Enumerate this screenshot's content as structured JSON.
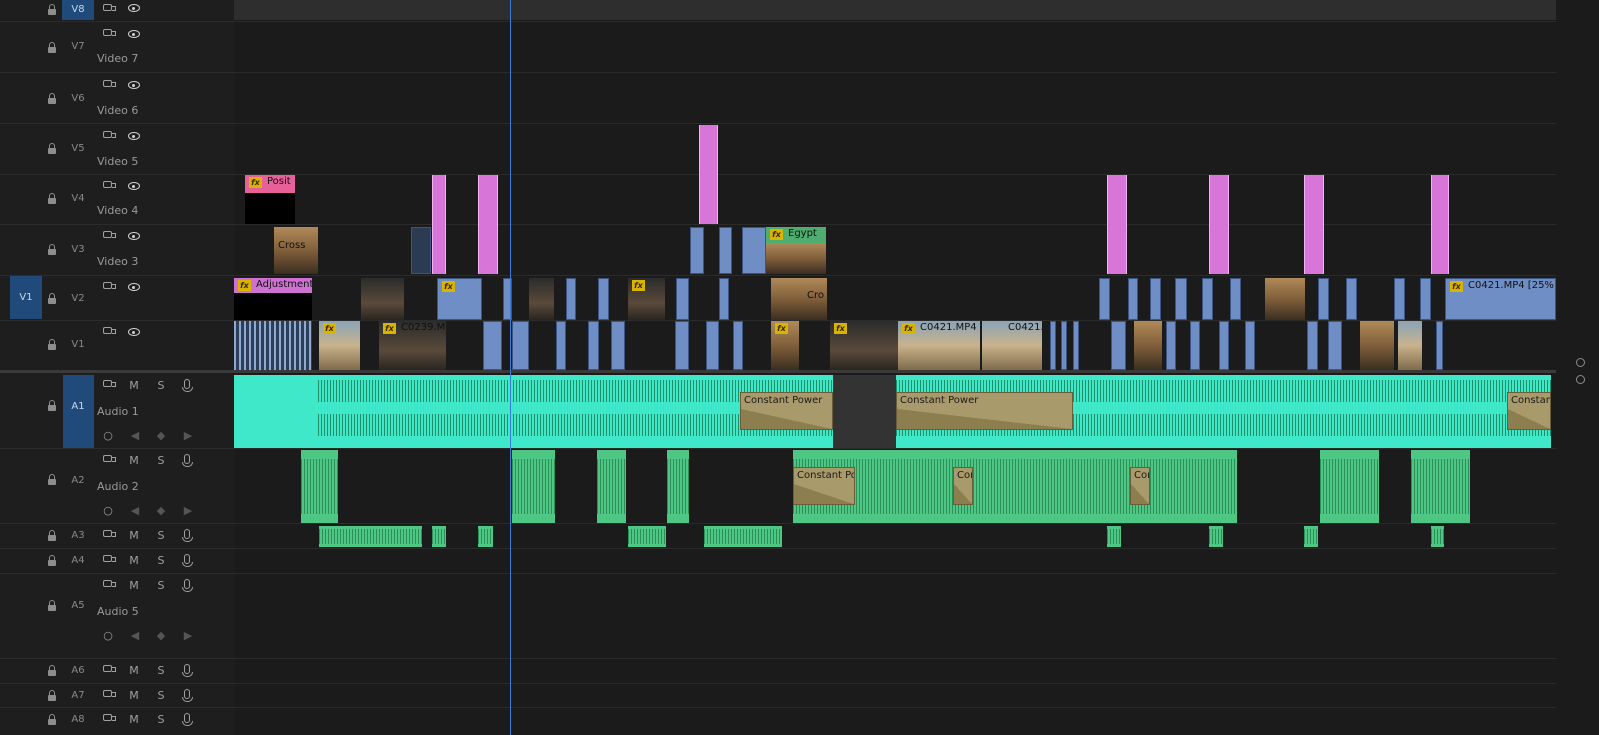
{
  "video_tracks": [
    {
      "id": "V8",
      "label": ""
    },
    {
      "id": "V7",
      "label": "Video 7"
    },
    {
      "id": "V6",
      "label": "Video 6"
    },
    {
      "id": "V5",
      "label": "Video 5"
    },
    {
      "id": "V4",
      "label": "Video 4"
    },
    {
      "id": "V3",
      "label": "Video 3"
    },
    {
      "id": "V2",
      "label": ""
    },
    {
      "id": "V1",
      "label": ""
    }
  ],
  "audio_tracks": [
    {
      "id": "A1",
      "label": "Audio 1"
    },
    {
      "id": "A2",
      "label": "Audio 2"
    },
    {
      "id": "A3",
      "label": ""
    },
    {
      "id": "A4",
      "label": ""
    },
    {
      "id": "A5",
      "label": "Audio 5"
    },
    {
      "id": "A6",
      "label": ""
    },
    {
      "id": "A7",
      "label": ""
    },
    {
      "id": "A8",
      "label": ""
    }
  ],
  "source_patch": {
    "video": "V1"
  },
  "toggles": {
    "mute": "M",
    "solo": "S"
  },
  "clips": {
    "posit": "Posit",
    "cross": "Cross",
    "adjustment": "Adjustment",
    "egypt": "Egypt",
    "c0421_25": "C0421.MP4 [25%]",
    "c0239": "C0239.M",
    "c0421_a": "C0421.MP4",
    "c0421_b": "C0421.",
    "cro": "Cro"
  },
  "fx_badge": "fx",
  "transitions": {
    "cp1": "Constant Power",
    "cp2": "Constant Power",
    "cp3": "Constant I",
    "cp4": "Constant Pow",
    "cp5": "Con",
    "cp6": "Con"
  },
  "colors": {
    "video_clip": "#6f8ec6",
    "nested_clip": "#d875d8",
    "adjustment_clip": "#cf71d2",
    "audio_selected": "#3ee8c9",
    "audio_clip": "#4fc784",
    "playhead": "#3a7bd5",
    "target_highlight": "#1f4a7a"
  }
}
